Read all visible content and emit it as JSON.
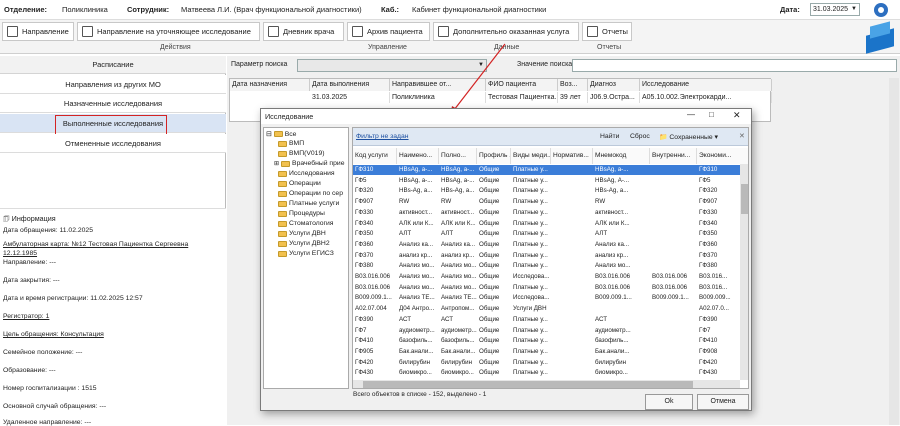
{
  "header": {
    "department_label": "Отделение:",
    "department": "Поликлиника",
    "employee_label": "Сотрудник:",
    "employee": "Матвеева Л.И. (Врач функциональной диагностики)",
    "office_label": "Каб.:",
    "office": "Кабинет функциональной диагностики",
    "date_label": "Дата:",
    "date": "31.03.2025"
  },
  "toolbar": {
    "buttons": [
      "Направление",
      "Направление на уточняющее исследование",
      "Дневник врача",
      "Архив пациента",
      "Дополнительно оказанная услуга",
      "Отчеты"
    ],
    "groups": [
      "Действия",
      "Управление",
      "Данные",
      "Отчеты"
    ]
  },
  "left": {
    "schedule": "Расписание",
    "items": [
      "Направления из других МО",
      "Назначенные исследования",
      "Выполненные исследования",
      "Отмененные исследования"
    ],
    "info_title": "Информация",
    "info": [
      "Дата обращения: 11.02.2025",
      "Амбулаторная карта: №12 Тестовая Пациентка Сергеевна",
      "12.12.1985",
      "Направление: ---",
      "Дата закрытия: ---",
      "Дата и время регистрации: 11.02.2025 12:57",
      "Регистратор: 1",
      "Цель обращения: Консультация",
      "Семейное положение: ---",
      "Образование: ---",
      "Номер госпитализации : 1515",
      "Основной случай обращения: ---",
      "Удаленное направление: ---"
    ]
  },
  "search": {
    "param_label": "Параметр поиска",
    "value_label": "Значение поиска"
  },
  "grid": {
    "headers": [
      "Дата назначения",
      "Дата выполнения",
      "Направившее от...",
      "ФИО пациента",
      "Воз...",
      "Диагноз",
      "Исследование"
    ],
    "row": [
      "",
      "31.03.2025",
      "Поликлиника",
      "Тестовая Пациентка...",
      "39 лет",
      "J06.9.Остра...",
      "A05.10.002.Электрокарди..."
    ]
  },
  "dialog": {
    "title": "Исследование",
    "filter": "Фильтр не задан",
    "find": "Найти",
    "reset": "Сброс",
    "saved": "Сохраненные",
    "tree_root": "Все",
    "tree": [
      "ВМП",
      "ВМП(V019)",
      "Врачебный прие",
      "Исследования",
      "Операции",
      "Операции по сер",
      "Платные услуги",
      "Процедуры",
      "Стоматология",
      "Услуги ДВН",
      "Услуги ДВН2",
      "Услуги ЕГИСЗ"
    ],
    "headers": [
      "Код услуги",
      "Наимено...",
      "Полно...",
      "Профиль ...",
      "Виды меди...",
      "Норматив...",
      "Мнемокод",
      "Внутренни...",
      "Экономи..."
    ],
    "rows": [
      [
        "ГФ310",
        "HBsAg, а-...",
        "HBsAg, а-...",
        "Общие",
        "Платные у...",
        "",
        "HBsAg, а-...",
        "",
        "ГФ310"
      ],
      [
        "ГФ5",
        "HBsAg, а-...",
        "HBsAg, а-...",
        "Общие",
        "Платные у...",
        "",
        "HBsAg, А-...",
        "",
        "ГФ5"
      ],
      [
        "ГФ320",
        "HBs-Ag, а...",
        "HBs-Ag, а...",
        "Общие",
        "Платные у...",
        "",
        "HBs-Ag, а...",
        "",
        "ГФ320"
      ],
      [
        "ГФ907",
        "RW",
        "RW",
        "Общие",
        "Платные у...",
        "",
        "RW",
        "",
        "ГФ907"
      ],
      [
        "ГФ330",
        "активност...",
        "активност...",
        "Общие",
        "Платные у...",
        "",
        "активност...",
        "",
        "ГФ330"
      ],
      [
        "ГФ340",
        "АЛК или К...",
        "АЛК или К...",
        "Общие",
        "Платные у...",
        "",
        "АЛК или К...",
        "",
        "ГФ340"
      ],
      [
        "ГФ350",
        "АЛТ",
        "АЛТ",
        "Общие",
        "Платные у...",
        "",
        "АЛТ",
        "",
        "ГФ350"
      ],
      [
        "ГФ360",
        "Анализ ка...",
        "Анализ ка...",
        "Общие",
        "Платные у...",
        "",
        "Анализ ка...",
        "",
        "ГФ360"
      ],
      [
        "ГФ370",
        "анализ кр...",
        "анализ кр...",
        "Общие",
        "Платные у...",
        "",
        "анализ кр...",
        "",
        "ГФ370"
      ],
      [
        "ГФ380",
        "Анализ мо...",
        "Анализ мо...",
        "Общие",
        "Платные у...",
        "",
        "Анализ мо...",
        "",
        "ГФ380"
      ],
      [
        "B03.016.006",
        "Анализ мо...",
        "Анализ мо...",
        "Общие",
        "Исследова...",
        "",
        "B03.016.006",
        "B03.016.006",
        "B03.016..."
      ],
      [
        "B03.016.006",
        "Анализ мо...",
        "Анализ мо...",
        "Общие",
        "Платные у...",
        "",
        "B03.016.006",
        "B03.016.006",
        "B03.016..."
      ],
      [
        "B009.009.1...",
        "Анализ ТЕ...",
        "Анализ ТЕ...",
        "Общие",
        "Исследова...",
        "",
        "B009.009.1...",
        "B009.009.1...",
        "B009.009..."
      ],
      [
        "A02.07.004",
        "Д04 Антро...",
        "Антропом...",
        "Общие",
        "Услуги ДВН",
        "",
        "",
        "",
        "A02.07.0..."
      ],
      [
        "ГФ390",
        "АСТ",
        "АСТ",
        "Общие",
        "Платные у...",
        "",
        "АСТ",
        "",
        "ГФ390"
      ],
      [
        "ГФ7",
        "аудиометр...",
        "аудиометр...",
        "Общие",
        "Платные у...",
        "",
        "аудиометр...",
        "",
        "ГФ7"
      ],
      [
        "ГФ410",
        "базофиль...",
        "базофиль...",
        "Общие",
        "Платные у...",
        "",
        "базофиль...",
        "",
        "ГФ410"
      ],
      [
        "ГФ905",
        "Бак.анали...",
        "Бак.анали...",
        "Общие",
        "Платные у...",
        "",
        "Бак.анали...",
        "",
        "ГФ908"
      ],
      [
        "ГФ420",
        "билирубин",
        "билирубин",
        "Общие",
        "Платные у...",
        "",
        "билирубин",
        "",
        "ГФ420"
      ],
      [
        "ГФ430",
        "биомикро...",
        "биомикро...",
        "Общие",
        "Платные у...",
        "",
        "биомикро...",
        "",
        "ГФ430"
      ]
    ],
    "status": "Всего объектов в списке - 152, выделено - 1",
    "ok": "Ok",
    "cancel": "Отмена"
  }
}
